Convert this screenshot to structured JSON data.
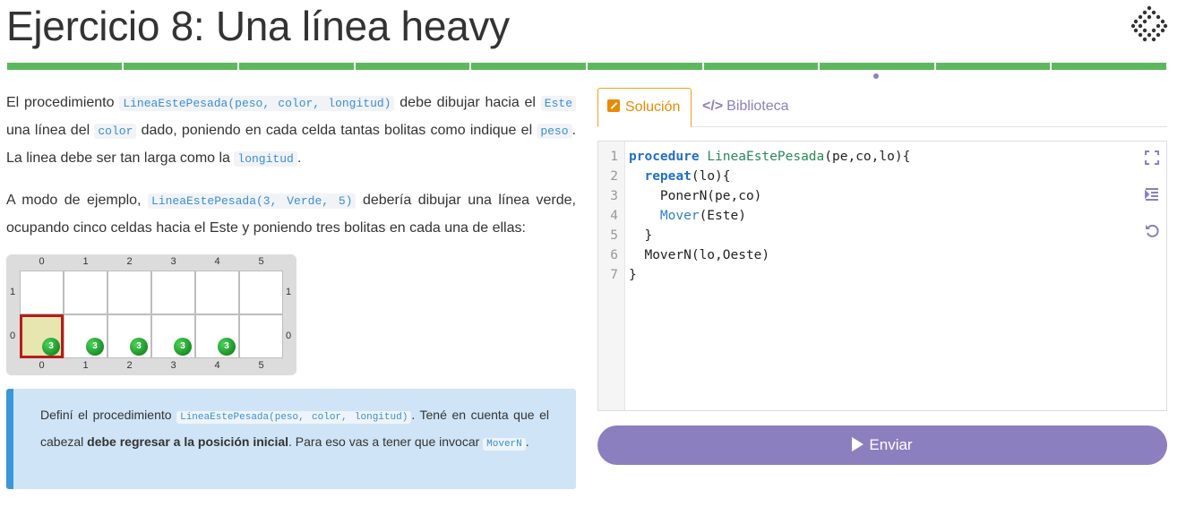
{
  "header": {
    "title": "Ejercicio 8: Una línea heavy",
    "progress_segments": 10,
    "current_segment": 8,
    "accent_color": "#5cb85c"
  },
  "statement": {
    "p1_a": "El procedimiento ",
    "p1_code1": "LineaEstePesada(peso, color, longitud)",
    "p1_b": " debe dibujar hacia el ",
    "p1_code2": "Este",
    "p1_c": " una línea del ",
    "p1_code3": "color",
    "p1_d": " dado, poniendo en cada celda tantas bolitas como indique el ",
    "p1_code4": "peso",
    "p1_e": ". La linea debe ser tan larga como la ",
    "p1_code5": "longitud",
    "p1_f": ".",
    "p2_a": "A modo de ejemplo, ",
    "p2_code": "LineaEstePesada(3, Verde, 5)",
    "p2_b": " debería dibujar una línea verde, ocupando cinco celdas hacia el Este y poniendo tres bolitas en cada una de ellas:"
  },
  "board": {
    "columns": [
      "0",
      "1",
      "2",
      "3",
      "4",
      "5"
    ],
    "rows": [
      "1",
      "0"
    ],
    "balls": [
      {
        "col": 0,
        "row": 0,
        "count": "3"
      },
      {
        "col": 1,
        "row": 0,
        "count": "3"
      },
      {
        "col": 2,
        "row": 0,
        "count": "3"
      },
      {
        "col": 3,
        "row": 0,
        "count": "3"
      },
      {
        "col": 4,
        "row": 0,
        "count": "3"
      }
    ],
    "head": {
      "col": 0,
      "row": 0
    },
    "ball_color": "#2ea83a"
  },
  "note": {
    "a": "Definí el procedimiento ",
    "code1": "LineaEstePesada(peso, color, longitud)",
    "b": ". Tené en cuenta que el cabezal ",
    "bold": "debe regresar a la posición inicial",
    "c": ". Para eso vas a tener que invocar ",
    "code2": "MoverN",
    "d": "."
  },
  "tabs": {
    "solution": "Solución",
    "library": "Biblioteca",
    "library_icon": "</>"
  },
  "editor": {
    "line_numbers": [
      "1",
      "2",
      "3",
      "4",
      "5",
      "6",
      "7"
    ],
    "l1_kw": "procedure",
    "l1_fn": "LineaEstePesada",
    "l1_rest": "(pe,co,lo){",
    "l2_kw": "repeat",
    "l2_rest": "(lo){",
    "l3": "PonerN(pe,co)",
    "l4_cmd": "Mover",
    "l4_rest": "(Este)",
    "l5": "}",
    "l6": "MoverN(lo,Oeste)",
    "l7": "}"
  },
  "submit": {
    "label": "Enviar",
    "color": "#8c7fbf"
  }
}
